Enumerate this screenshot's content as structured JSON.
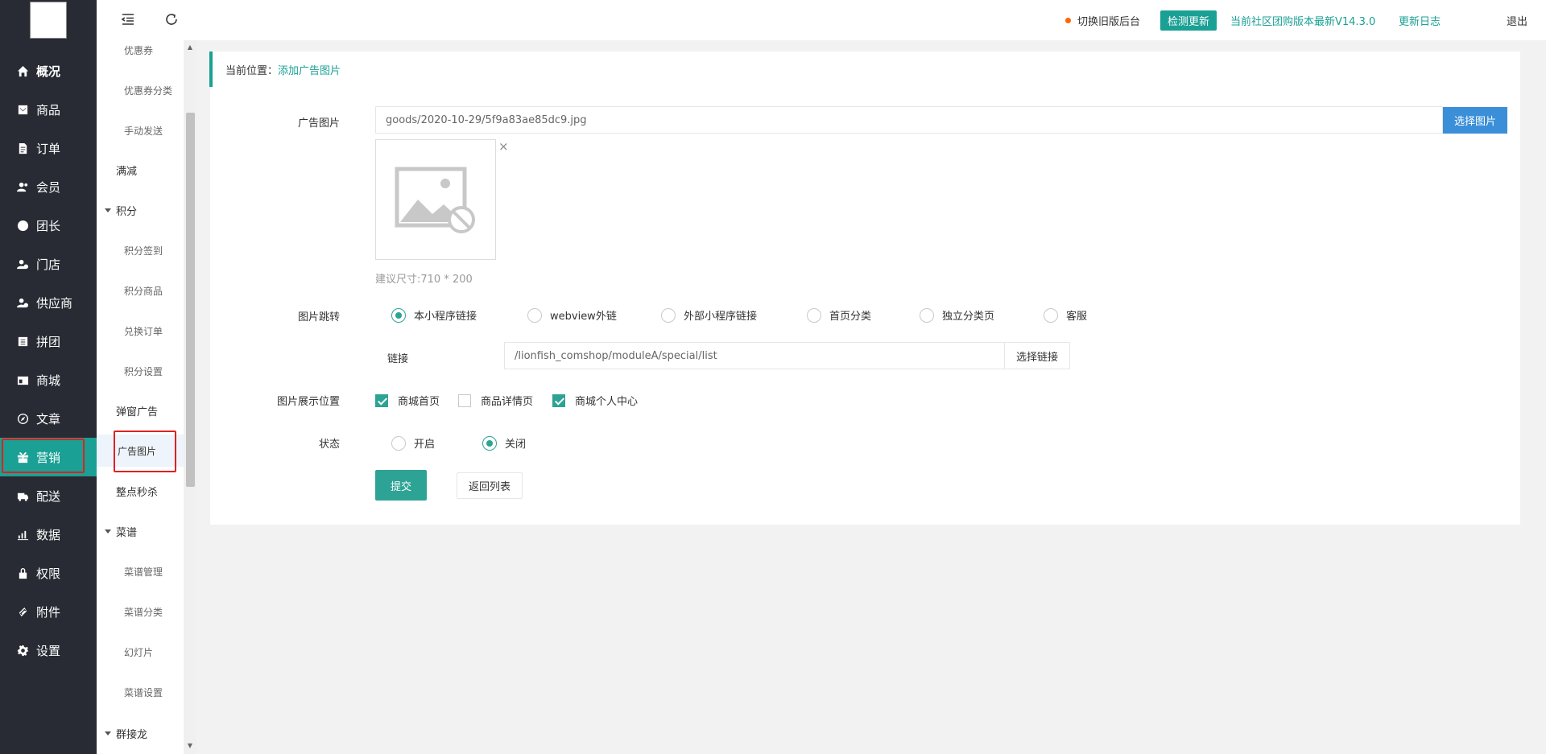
{
  "sidebar": {
    "items": [
      {
        "label": "概况",
        "icon": "home-icon"
      },
      {
        "label": "商品",
        "icon": "goods-icon"
      },
      {
        "label": "订单",
        "icon": "order-icon"
      },
      {
        "label": "会员",
        "icon": "member-icon"
      },
      {
        "label": "团长",
        "icon": "leader-icon"
      },
      {
        "label": "门店",
        "icon": "store-icon"
      },
      {
        "label": "供应商",
        "icon": "supplier-icon"
      },
      {
        "label": "拼团",
        "icon": "group-buy-icon"
      },
      {
        "label": "商城",
        "icon": "mall-icon"
      },
      {
        "label": "文章",
        "icon": "compass-icon"
      },
      {
        "label": "营销",
        "icon": "gift-icon"
      },
      {
        "label": "配送",
        "icon": "truck-icon"
      },
      {
        "label": "数据",
        "icon": "chart-icon"
      },
      {
        "label": "权限",
        "icon": "lock-icon"
      },
      {
        "label": "附件",
        "icon": "link-icon"
      },
      {
        "label": "设置",
        "icon": "gear-icon"
      }
    ],
    "active": "营销"
  },
  "submenu": {
    "items": [
      {
        "label": "优惠券"
      },
      {
        "label": "优惠券分类"
      },
      {
        "label": "手动发送"
      },
      {
        "label": "满减"
      },
      {
        "label": "积分"
      },
      {
        "label": "积分签到"
      },
      {
        "label": "积分商品"
      },
      {
        "label": "兑换订单"
      },
      {
        "label": "积分设置"
      },
      {
        "label": "弹窗广告"
      },
      {
        "label": "广告图片"
      },
      {
        "label": "整点秒杀"
      },
      {
        "label": "菜谱"
      },
      {
        "label": "菜谱管理"
      },
      {
        "label": "菜谱分类"
      },
      {
        "label": "幻灯片"
      },
      {
        "label": "菜谱设置"
      },
      {
        "label": "群接龙"
      }
    ],
    "active": "广告图片"
  },
  "topbar": {
    "switch_label": "切换旧版后台",
    "check_update": "检测更新",
    "version_text": "当前社区团购版本最新V14.3.0",
    "changelog": "更新日志",
    "logout": "退出"
  },
  "breadcrumb": {
    "prefix": "当前位置：",
    "current": "添加广告图片"
  },
  "form": {
    "image_label": "广告图片",
    "image_value": "goods/2020-10-29/5f9a83ae85dc9.jpg",
    "choose_image": "选择图片",
    "close": "×",
    "size_hint": "建议尺寸:710 * 200",
    "jump_label": "图片跳转",
    "jump_options": [
      "本小程序链接",
      "webview外链",
      "外部小程序链接",
      "首页分类",
      "独立分类页",
      "客服"
    ],
    "jump_selected": "本小程序链接",
    "link_label": "链接",
    "link_value": "/lionfish_comshop/moduleA/special/list",
    "choose_link": "选择链接",
    "position_label": "图片展示位置",
    "positions": [
      {
        "label": "商城首页",
        "checked": true
      },
      {
        "label": "商品详情页",
        "checked": false
      },
      {
        "label": "商城个人中心",
        "checked": true
      }
    ],
    "status_label": "状态",
    "status_options": [
      "开启",
      "关闭"
    ],
    "status_selected": "关闭",
    "submit": "提交",
    "back": "返回列表"
  },
  "colors": {
    "accent": "#1aa094",
    "sidebar_bg": "#282b33",
    "primary_btn": "#3b8fd8",
    "highlight": "#e02020"
  }
}
